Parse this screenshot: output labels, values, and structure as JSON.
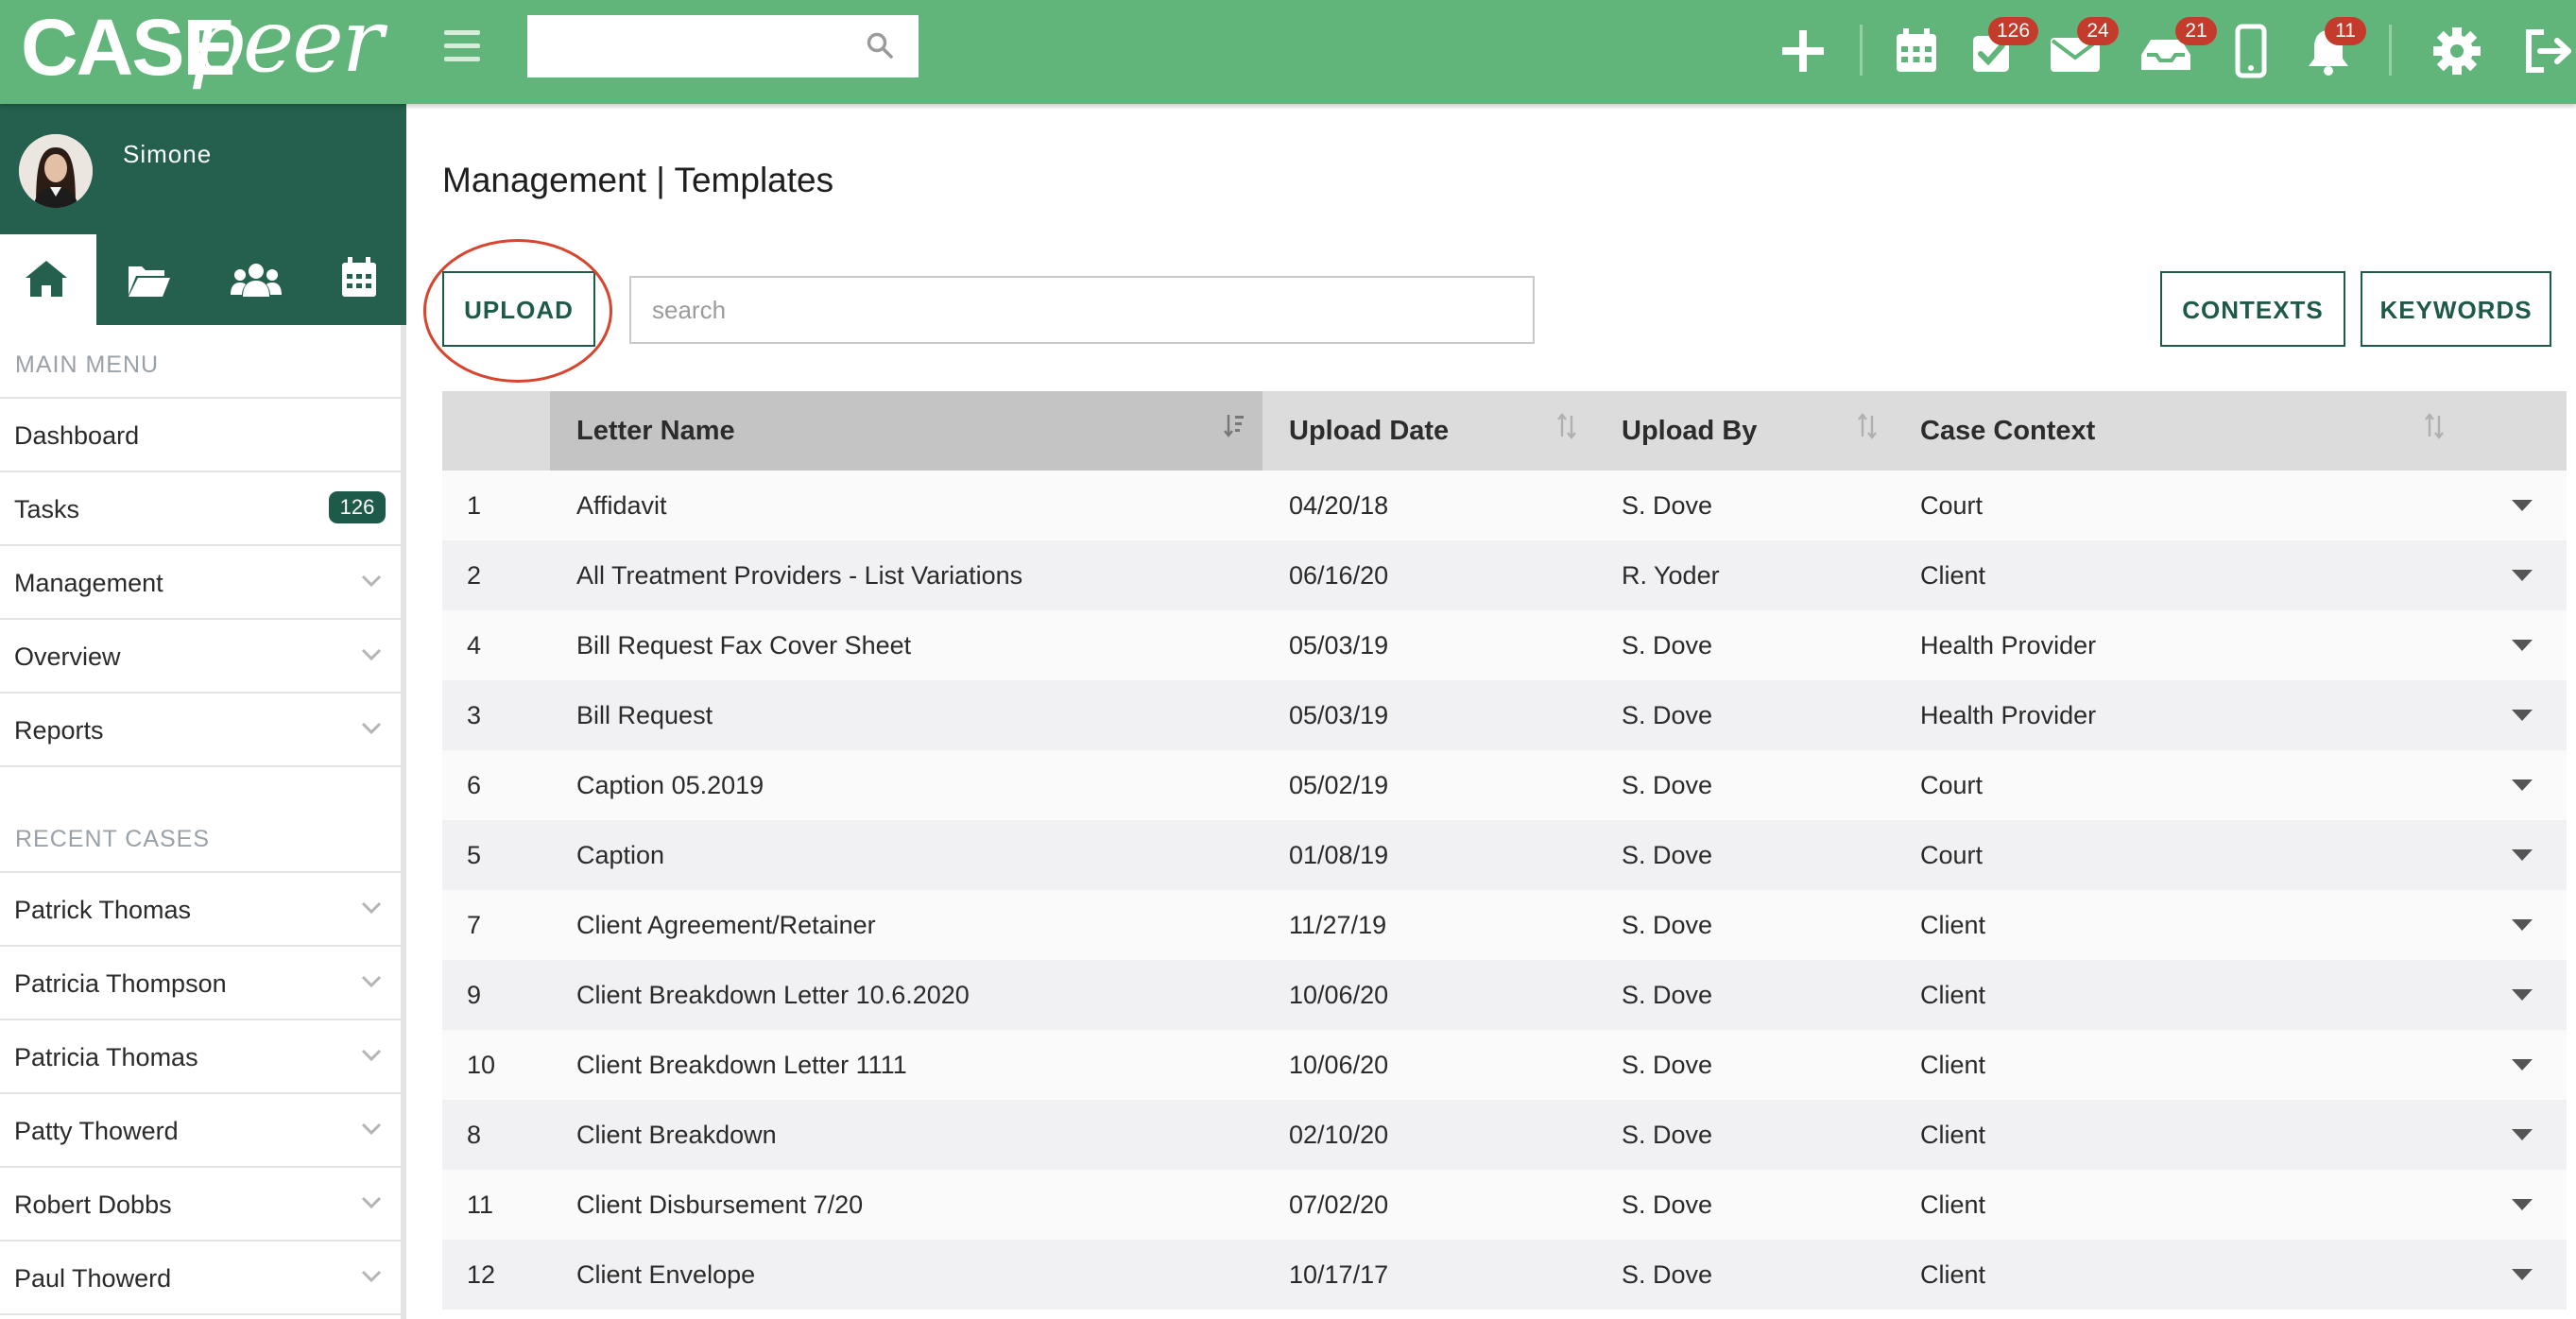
{
  "brand": {
    "case": "CASE",
    "peer": "peer"
  },
  "topbar": {
    "search_placeholder": "",
    "icons": [
      "plus-icon",
      "calendar-icon",
      "tasks-check-icon",
      "mail-icon",
      "inbox-icon",
      "phone-icon",
      "bell-icon",
      "gear-icon",
      "logout-icon"
    ],
    "badges": {
      "tasks": "126",
      "mail": "24",
      "inbox": "21",
      "notifications": "11"
    }
  },
  "colors": {
    "topbar": "#62b57a",
    "sidebar_dark": "#24604d",
    "accent": "#1e5a49",
    "badge_red": "#c43b2b",
    "highlight_ring": "#d8442e"
  },
  "sidebar": {
    "username": "Simone",
    "nav_tabs": [
      "home-icon",
      "folder-icon",
      "users-icon",
      "calendar-icon"
    ],
    "main_menu_label": "MAIN MENU",
    "main_menu": [
      {
        "label": "Dashboard",
        "chevron": false
      },
      {
        "label": "Tasks",
        "badge": "126",
        "chevron": false
      },
      {
        "label": "Management",
        "chevron": true
      },
      {
        "label": "Overview",
        "chevron": true
      },
      {
        "label": "Reports",
        "chevron": true
      }
    ],
    "recent_cases_label": "RECENT CASES",
    "recent_cases": [
      {
        "label": "Patrick Thomas"
      },
      {
        "label": "Patricia Thompson"
      },
      {
        "label": "Patricia Thomas"
      },
      {
        "label": "Patty Thowerd"
      },
      {
        "label": "Robert Dobbs"
      },
      {
        "label": "Paul Thowerd"
      }
    ]
  },
  "main": {
    "title": "Management | Templates",
    "upload_label": "UPLOAD",
    "search_placeholder": "search",
    "contexts_label": "CONTEXTS",
    "keywords_label": "KEYWORDS",
    "columns": [
      "Letter Name",
      "Upload Date",
      "Upload By",
      "Case Context"
    ],
    "rows": [
      {
        "id": "1",
        "name": "Affidavit",
        "date": "04/20/18",
        "by": "S. Dove",
        "context": "Court"
      },
      {
        "id": "2",
        "name": "All Treatment Providers - List Variations",
        "date": "06/16/20",
        "by": "R. Yoder",
        "context": "Client"
      },
      {
        "id": "4",
        "name": "Bill Request Fax Cover Sheet",
        "date": "05/03/19",
        "by": "S. Dove",
        "context": "Health Provider"
      },
      {
        "id": "3",
        "name": "Bill Request",
        "date": "05/03/19",
        "by": "S. Dove",
        "context": "Health Provider"
      },
      {
        "id": "6",
        "name": "Caption 05.2019",
        "date": "05/02/19",
        "by": "S. Dove",
        "context": "Court"
      },
      {
        "id": "5",
        "name": "Caption",
        "date": "01/08/19",
        "by": "S. Dove",
        "context": "Court"
      },
      {
        "id": "7",
        "name": "Client Agreement/Retainer",
        "date": "11/27/19",
        "by": "S. Dove",
        "context": "Client"
      },
      {
        "id": "9",
        "name": "Client Breakdown Letter 10.6.2020",
        "date": "10/06/20",
        "by": "S. Dove",
        "context": "Client"
      },
      {
        "id": "10",
        "name": "Client Breakdown Letter 1111",
        "date": "10/06/20",
        "by": "S. Dove",
        "context": "Client"
      },
      {
        "id": "8",
        "name": "Client Breakdown",
        "date": "02/10/20",
        "by": "S. Dove",
        "context": "Client"
      },
      {
        "id": "11",
        "name": "Client Disbursement 7/20",
        "date": "07/02/20",
        "by": "S. Dove",
        "context": "Client"
      },
      {
        "id": "12",
        "name": "Client Envelope",
        "date": "10/17/17",
        "by": "S. Dove",
        "context": "Client"
      }
    ]
  }
}
